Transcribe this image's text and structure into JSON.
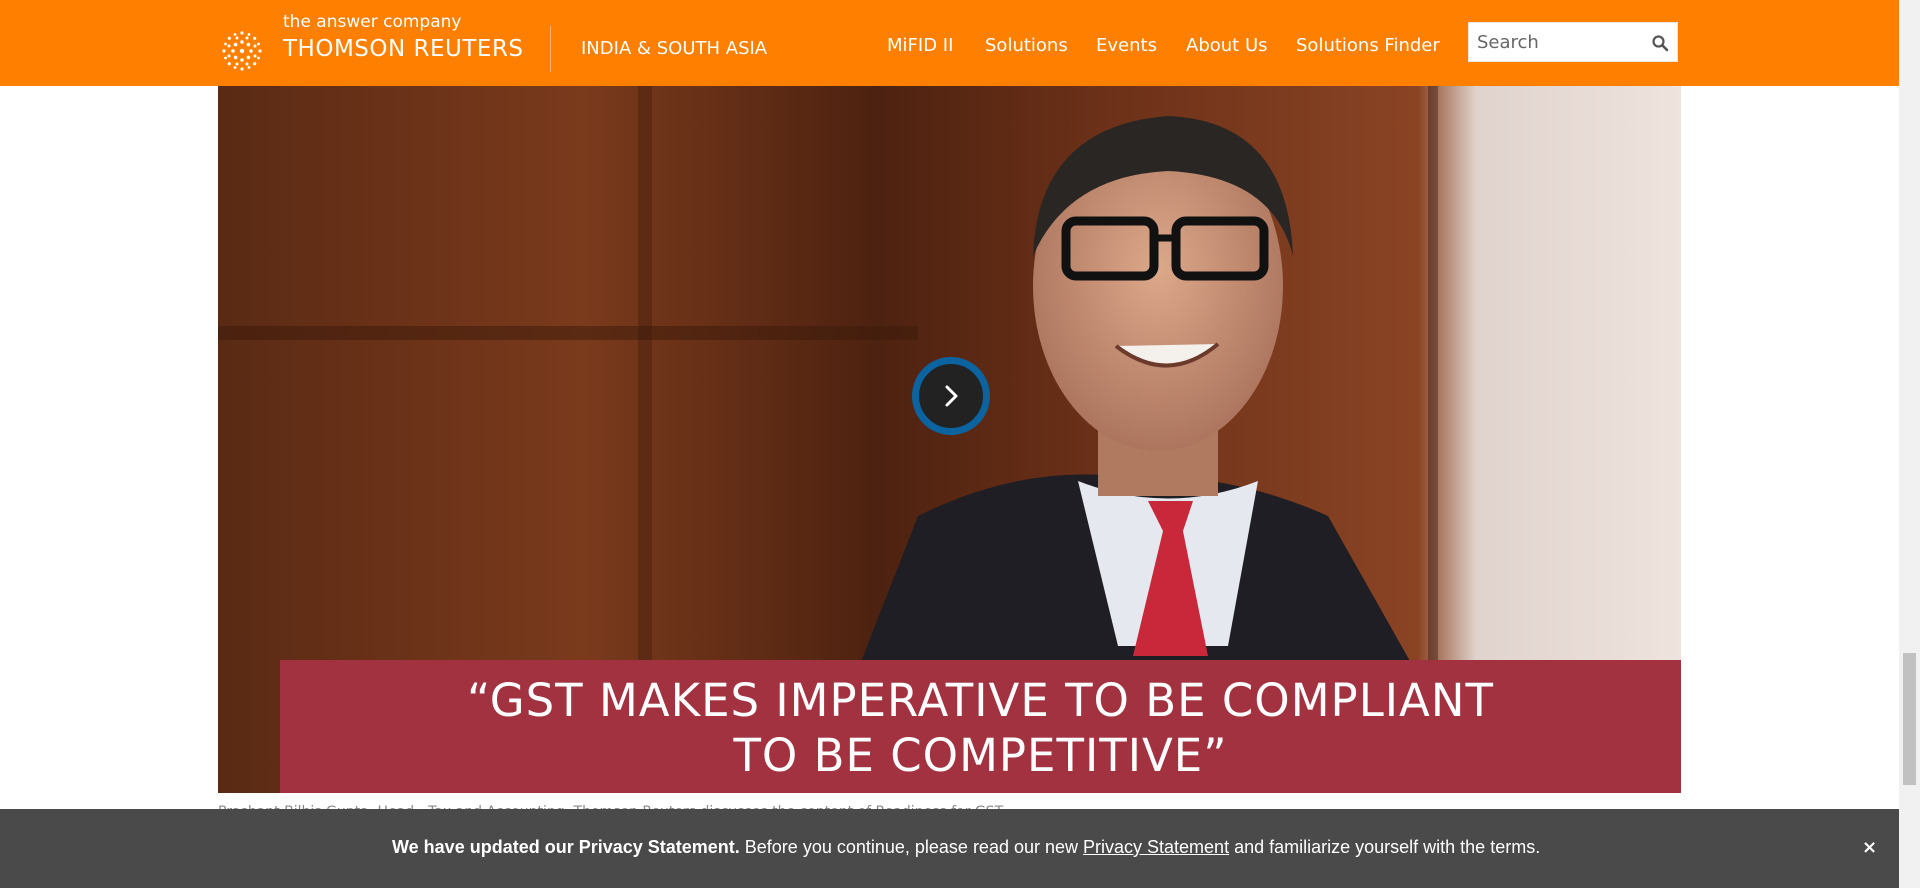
{
  "header": {
    "tagline": "the answer company",
    "brand": "THOMSON REUTERS",
    "region": "INDIA & SOUTH ASIA",
    "nav": [
      "MiFID II",
      "Solutions",
      "Events",
      "About Us",
      "Solutions Finder"
    ],
    "search_placeholder": "Search",
    "bg_color": "#ff8000"
  },
  "hero": {
    "quote_line1": "“GST MAKES IMPERATIVE TO BE COMPLIANT",
    "quote_line2": "TO BE COMPETITIVE”",
    "banner_color": "#a33240",
    "play_icon": "play-icon"
  },
  "caption": "Prashant Bilhis Gupta, Head - Tax and Accounting, Thomson Reuters discusses the content of Readiness for GST.",
  "privacy": {
    "bold": "We have updated our Privacy Statement.",
    "text1": " Before you continue, please read our new ",
    "link": "Privacy Statement",
    "text2": " and familiarize yourself with the terms.",
    "close": "×"
  }
}
